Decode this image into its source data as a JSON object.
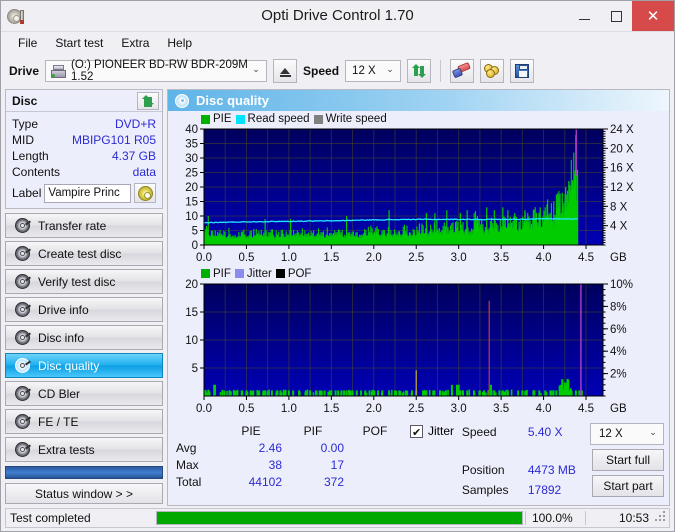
{
  "window": {
    "title": "Opti Drive Control 1.70",
    "app_icon": "disc-pen-icon",
    "minimize": "–",
    "maximize": "□",
    "close": "✕"
  },
  "menu": {
    "items": [
      {
        "label": "File"
      },
      {
        "label": "Start test"
      },
      {
        "label": "Extra"
      },
      {
        "label": "Help"
      }
    ]
  },
  "toolbar": {
    "drive_label": "Drive",
    "drive_value": "(O:)  PIONEER BD-RW   BDR-209M 1.52",
    "eject_icon": "eject-icon",
    "speed_label": "Speed",
    "speed_value": "12 X",
    "refresh_icon": "swap-arrows-icon",
    "erase_icon": "eraser-icon",
    "coins_icon": "coins-icon",
    "save_icon": "save-disk-icon"
  },
  "disc_panel": {
    "title": "Disc",
    "refresh_icon": "swap-arrows-icon",
    "rows": [
      {
        "key": "Type",
        "value": "DVD+R"
      },
      {
        "key": "MID",
        "value": "MBIPG101 R05"
      },
      {
        "key": "Length",
        "value": "4.37 GB"
      },
      {
        "key": "Contents",
        "value": "data"
      }
    ],
    "label_key": "Label",
    "label_value": "Vampire Princ",
    "disc_icon": "cd-icon"
  },
  "nav": {
    "items": [
      {
        "label": "Transfer rate",
        "icon": "disc-icon",
        "active": false
      },
      {
        "label": "Create test disc",
        "icon": "disc-icon",
        "active": false
      },
      {
        "label": "Verify test disc",
        "icon": "disc-icon",
        "active": false
      },
      {
        "label": "Drive info",
        "icon": "disc-icon",
        "active": false
      },
      {
        "label": "Disc info",
        "icon": "disc-icon",
        "active": false
      },
      {
        "label": "Disc quality",
        "icon": "disc-icon",
        "active": true
      },
      {
        "label": "CD Bler",
        "icon": "disc-icon",
        "active": false
      },
      {
        "label": "FE / TE",
        "icon": "disc-icon",
        "active": false
      },
      {
        "label": "Extra tests",
        "icon": "disc-icon",
        "active": false
      }
    ],
    "status_window_label": "Status window > >"
  },
  "main": {
    "title": "Disc quality",
    "icon": "disc-icon"
  },
  "stats": {
    "headers": [
      "",
      "PIE",
      "PIF",
      "POF"
    ],
    "jitter_label": "Jitter",
    "jitter_checked": true,
    "rows": [
      {
        "key": "Avg",
        "pie": "2.46",
        "pif": "0.00",
        "pof": ""
      },
      {
        "key": "Max",
        "pie": "38",
        "pif": "17",
        "pof": ""
      },
      {
        "key": "Total",
        "pie": "44102",
        "pif": "372",
        "pof": ""
      }
    ],
    "speed_key": "Speed",
    "speed_value": "5.40 X",
    "position_key": "Position",
    "position_value": "4473 MB",
    "samples_key": "Samples",
    "samples_value": "17892",
    "speed_select": "12 X",
    "start_full": "Start full",
    "start_part": "Start part"
  },
  "statusbar": {
    "text": "Test completed",
    "percent_label": "100.0%",
    "percent_value": 100,
    "time": "10:53"
  },
  "colors": {
    "accent": "#1fb0f0",
    "pie_green": "#00cc00",
    "read_speed_cyan": "#00e5ff",
    "write_speed_gray": "#808080",
    "jitter_violet": "#8c8cf0",
    "pof_black": "#000000",
    "plot_bg_top": "#000060",
    "plot_bg_bottom": "#0000a8",
    "value_blue": "#2b2bd4",
    "progress_green": "#00a800",
    "close_red": "#d64a4a"
  },
  "chart_data": [
    {
      "type": "area",
      "name": "pie-chart",
      "title": "",
      "xlabel": "GB",
      "ylabel": "",
      "xlim": [
        0,
        4.7
      ],
      "ylim": [
        0,
        40
      ],
      "y2lim": [
        0,
        24
      ],
      "y2label": "X",
      "xticks": [
        "0.0",
        "0.5",
        "1.0",
        "1.5",
        "2.0",
        "2.5",
        "3.0",
        "3.5",
        "4.0",
        "4.5"
      ],
      "yticks": [
        "0",
        "5",
        "10",
        "15",
        "20",
        "25",
        "30",
        "35",
        "40"
      ],
      "y2ticks": [
        "4 X",
        "8 X",
        "12 X",
        "16 X",
        "20 X",
        "24 X"
      ],
      "grid": true,
      "legend": [
        {
          "label": "PIE",
          "color": "#00b000"
        },
        {
          "label": "Read speed",
          "color": "#00e5ff"
        },
        {
          "label": "Write speed",
          "color": "#808080"
        }
      ],
      "series": [
        {
          "name": "PIE",
          "color": "#00cc00",
          "x": [
            0.0,
            0.05,
            0.1,
            0.15,
            0.2,
            0.25,
            0.3,
            0.35,
            0.4,
            0.45,
            0.5,
            0.55,
            0.6,
            0.65,
            0.7,
            0.75,
            0.8,
            0.85,
            0.9,
            0.95,
            1.0,
            1.05,
            1.1,
            1.15,
            1.2,
            1.25,
            1.3,
            1.35,
            1.4,
            1.45,
            1.5,
            1.55,
            1.6,
            1.65,
            1.7,
            1.75,
            1.8,
            1.85,
            1.9,
            1.95,
            2.0,
            2.05,
            2.1,
            2.15,
            2.2,
            2.25,
            2.3,
            2.35,
            2.4,
            2.45,
            2.5,
            2.55,
            2.6,
            2.65,
            2.7,
            2.75,
            2.8,
            2.85,
            2.9,
            2.95,
            3.0,
            3.05,
            3.1,
            3.15,
            3.2,
            3.25,
            3.3,
            3.35,
            3.4,
            3.45,
            3.5,
            3.55,
            3.6,
            3.65,
            3.7,
            3.75,
            3.8,
            3.85,
            3.9,
            3.95,
            4.0,
            4.05,
            4.1,
            4.15,
            4.2,
            4.25,
            4.3,
            4.35,
            4.4
          ],
          "values": [
            8,
            7,
            6,
            5,
            6,
            5,
            6,
            6,
            5,
            5,
            6,
            5,
            6,
            6,
            5,
            6,
            7,
            5,
            6,
            5,
            6,
            5,
            6,
            6,
            5,
            5,
            6,
            6,
            5,
            6,
            6,
            5,
            6,
            5,
            6,
            6,
            5,
            6,
            6,
            7,
            6,
            7,
            6,
            6,
            6,
            7,
            6,
            7,
            7,
            6,
            7,
            8,
            7,
            8,
            7,
            9,
            8,
            8,
            7,
            8,
            9,
            8,
            9,
            9,
            12,
            9,
            10,
            11,
            9,
            10,
            9,
            11,
            10,
            11,
            10,
            11,
            12,
            11,
            13,
            12,
            14,
            16,
            15,
            18,
            20,
            17,
            22,
            38,
            23
          ]
        },
        {
          "name": "Read speed",
          "color": "#00e5ff",
          "x": [
            0.0,
            0.5,
            1.0,
            1.5,
            2.0,
            2.5,
            3.0,
            3.5,
            4.0,
            4.4
          ],
          "values_x": [
            4.6,
            4.8,
            4.9,
            5.0,
            5.2,
            5.3,
            5.3,
            5.3,
            5.4,
            5.4
          ]
        }
      ],
      "summary": {
        "avg": 2.46,
        "max": 38,
        "total": 44102
      }
    },
    {
      "type": "bar",
      "name": "pif-chart",
      "title": "",
      "xlabel": "GB",
      "ylabel": "",
      "xlim": [
        0,
        4.7
      ],
      "ylim": [
        0,
        20
      ],
      "y2lim": [
        0,
        10
      ],
      "y2label": "%",
      "xticks": [
        "0.0",
        "0.5",
        "1.0",
        "1.5",
        "2.0",
        "2.5",
        "3.0",
        "3.5",
        "4.0",
        "4.5"
      ],
      "yticks": [
        "5",
        "10",
        "15",
        "20"
      ],
      "y2ticks": [
        "2%",
        "4%",
        "6%",
        "8%",
        "10%"
      ],
      "grid": true,
      "legend": [
        {
          "label": "PIF",
          "color": "#00b000"
        },
        {
          "label": "Jitter",
          "color": "#8c8cf0"
        },
        {
          "label": "POF",
          "color": "#000000"
        }
      ],
      "series": [
        {
          "name": "PIF",
          "color": "#00cc00",
          "x": [
            0.02,
            0.05,
            0.12,
            0.13,
            0.22,
            0.3,
            0.38,
            0.45,
            0.5,
            0.55,
            0.58,
            0.65,
            0.7,
            0.72,
            0.8,
            0.86,
            0.9,
            0.95,
            1.0,
            1.05,
            1.12,
            1.2,
            1.25,
            1.32,
            1.38,
            1.42,
            1.48,
            1.55,
            1.58,
            1.62,
            1.65,
            1.68,
            1.72,
            1.75,
            1.8,
            1.85,
            1.9,
            1.95,
            2.0,
            2.05,
            2.1,
            2.18,
            2.25,
            2.3,
            2.38,
            2.45,
            2.5,
            2.58,
            2.62,
            2.7,
            2.78,
            2.85,
            2.92,
            2.98,
            3.0,
            3.02,
            3.05,
            3.1,
            3.18,
            3.25,
            3.3,
            3.35,
            3.38,
            3.42,
            3.48,
            3.52,
            3.58,
            3.7,
            3.75,
            3.8,
            3.88,
            3.95,
            4.02,
            4.08,
            4.15,
            4.2,
            4.22,
            4.25,
            4.28,
            4.32,
            4.38,
            4.42,
            4.45
          ],
          "values": [
            1,
            1,
            2,
            2,
            1,
            1,
            1,
            1,
            1,
            1,
            1,
            1,
            1,
            1,
            1,
            1,
            1,
            1,
            1,
            1,
            1,
            1,
            1,
            1,
            1,
            1,
            1,
            1,
            1,
            1,
            1,
            1,
            1,
            1,
            1,
            1,
            1,
            1,
            1,
            1,
            1,
            1,
            1,
            1,
            1,
            1,
            1,
            1,
            1,
            1,
            1,
            1,
            2,
            2,
            2,
            1,
            1,
            1,
            1,
            1,
            1,
            1,
            2,
            1,
            1,
            1,
            1,
            1,
            1,
            1,
            1,
            1,
            1,
            1,
            1,
            2,
            3,
            2,
            1,
            1,
            1,
            1,
            1
          ]
        },
        {
          "name": "POF",
          "color": "#c0392b",
          "x": [
            3.36
          ],
          "values": [
            8.5
          ]
        },
        {
          "name": "Jitter",
          "color": "#8c8cf0",
          "x": [
            2.5,
            4.44
          ],
          "values": [
            2.3,
            10.0
          ]
        }
      ],
      "summary": {
        "avg": 0.0,
        "max": 17,
        "total": 372
      }
    }
  ]
}
